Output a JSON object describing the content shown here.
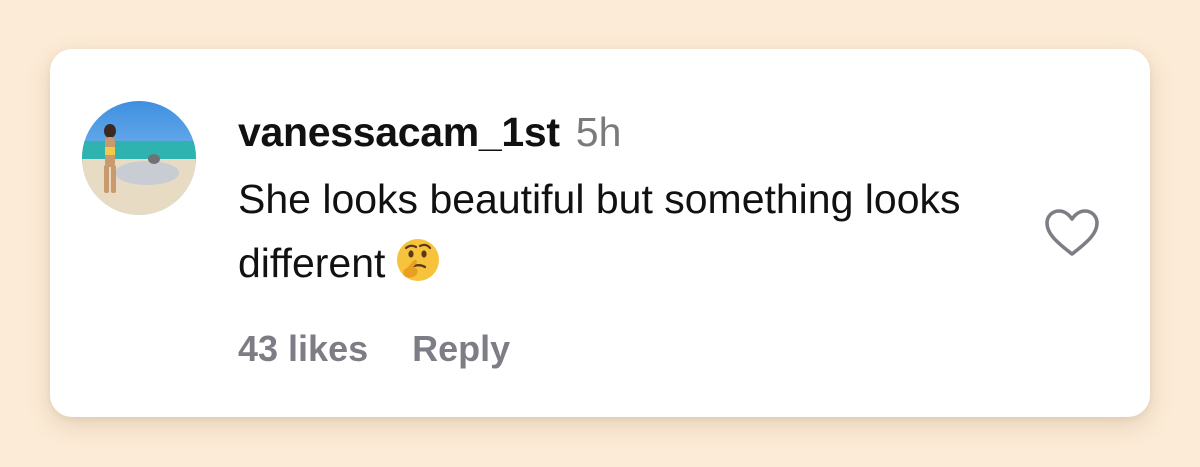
{
  "comment": {
    "username": "vanessacam_1st",
    "time": "5h",
    "text": "She looks beautiful but something looks different",
    "emoji": "thinking-face-emoji"
  },
  "actions": {
    "likes": "43 likes",
    "reply": "Reply"
  },
  "icons": {
    "like": "heart-outline-icon"
  },
  "colors": {
    "background": "#fcebd6",
    "card": "#ffffff",
    "text": "#111111",
    "muted": "#7d7d85"
  }
}
